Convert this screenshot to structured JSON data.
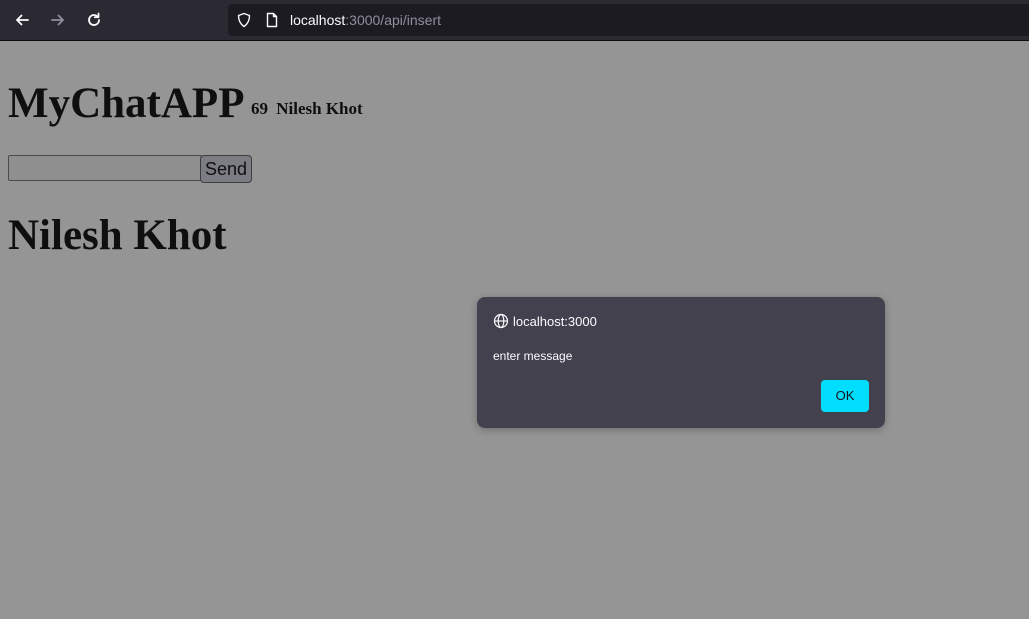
{
  "browser": {
    "url_host": "localhost",
    "url_rest": ":3000/api/insert",
    "icons": [
      "back-arrow-icon",
      "forward-arrow-icon",
      "reload-icon",
      "shield-icon",
      "page-icon"
    ]
  },
  "app": {
    "title": "MyChatAPP",
    "user_id": "69",
    "user_name": "Nilesh Khot",
    "message_input_value": "",
    "send_label": "Send",
    "chat_heading": "Nilesh Khot"
  },
  "alert_dialog": {
    "origin": "localhost:3000",
    "message": "enter message",
    "ok_label": "OK",
    "accent_color": "#00ddff"
  }
}
